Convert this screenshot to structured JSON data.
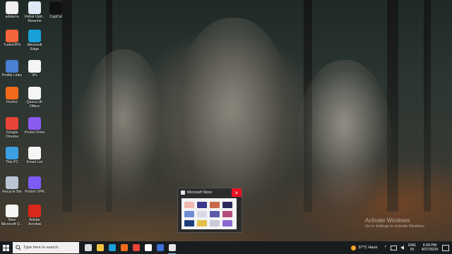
{
  "desktop": {
    "icons": [
      {
        "label": "adsterra",
        "icon": "file-icon",
        "color": "#f0f0f0"
      },
      {
        "label": "Vishal-Upd...\nResume",
        "icon": "document-icon",
        "color": "#dfe8f5"
      },
      {
        "label": "CapCut",
        "icon": "capcut-icon",
        "color": "#111111"
      },
      {
        "label": "TurboVPN",
        "icon": "turbovpn-icon",
        "color": "#f2643a"
      },
      {
        "label": "Microsoft\nEdge",
        "icon": "edge-icon",
        "color": "#1aa0d8"
      },
      {
        "label": "Profile Links",
        "icon": "shortcut-icon",
        "color": "#4a7fd1"
      },
      {
        "label": "IPs",
        "icon": "text-file-icon",
        "color": "#f5f5f5"
      },
      {
        "label": "Firefox",
        "icon": "firefox-icon",
        "color": "#f26b1d"
      },
      {
        "label": "Quora UK\nOffers",
        "icon": "text-file-icon",
        "color": "#f5f5f5"
      },
      {
        "label": "Google\nChrome",
        "icon": "chrome-icon",
        "color": "#e8443a"
      },
      {
        "label": "Proton Drive",
        "icon": "folder-icon",
        "color": "#8a5cf0"
      },
      {
        "label": "This PC",
        "icon": "computer-icon",
        "color": "#3c9ee3"
      },
      {
        "label": "Email List",
        "icon": "text-file-icon",
        "color": "#f5f5f5"
      },
      {
        "label": "Recycle Bin",
        "icon": "recycle-bin-icon",
        "color": "#b9c6d2"
      },
      {
        "label": "Proton VPN",
        "icon": "protonvpn-icon",
        "color": "#7d5cf5"
      },
      {
        "label": "New\nMicrosoft O...",
        "icon": "office-doc-icon",
        "color": "#f5f5f5"
      },
      {
        "label": "Adobe\nAcrobat",
        "icon": "acrobat-icon",
        "color": "#d8281c"
      }
    ]
  },
  "preview": {
    "title": "Microsoft Store",
    "close_glyph": "×"
  },
  "watermark": {
    "line1": "Activate Windows",
    "line2": "Go to Settings to activate Windows."
  },
  "taskbar": {
    "search_placeholder": "Type here to search",
    "apps": [
      {
        "name": "taskbar-task-view",
        "color": "#dddddd",
        "active": false
      },
      {
        "name": "taskbar-file-explorer",
        "color": "#f4c542",
        "active": false
      },
      {
        "name": "taskbar-edge",
        "color": "#1aa0d8",
        "active": false
      },
      {
        "name": "taskbar-firefox",
        "color": "#f26b1d",
        "active": false
      },
      {
        "name": "taskbar-chrome",
        "color": "#e8443a",
        "active": false
      },
      {
        "name": "taskbar-capcut",
        "color": "#ffffff",
        "active": false
      },
      {
        "name": "taskbar-app-blue",
        "color": "#3c6fd8",
        "active": false
      },
      {
        "name": "taskbar-microsoft-store",
        "color": "#e4e4e4",
        "active": true
      }
    ],
    "weather": "37°C  Haze",
    "tray_chevron": "^",
    "language": "ENG",
    "region": "IN",
    "time": "6:09 PM",
    "date": "4/27/2024"
  }
}
